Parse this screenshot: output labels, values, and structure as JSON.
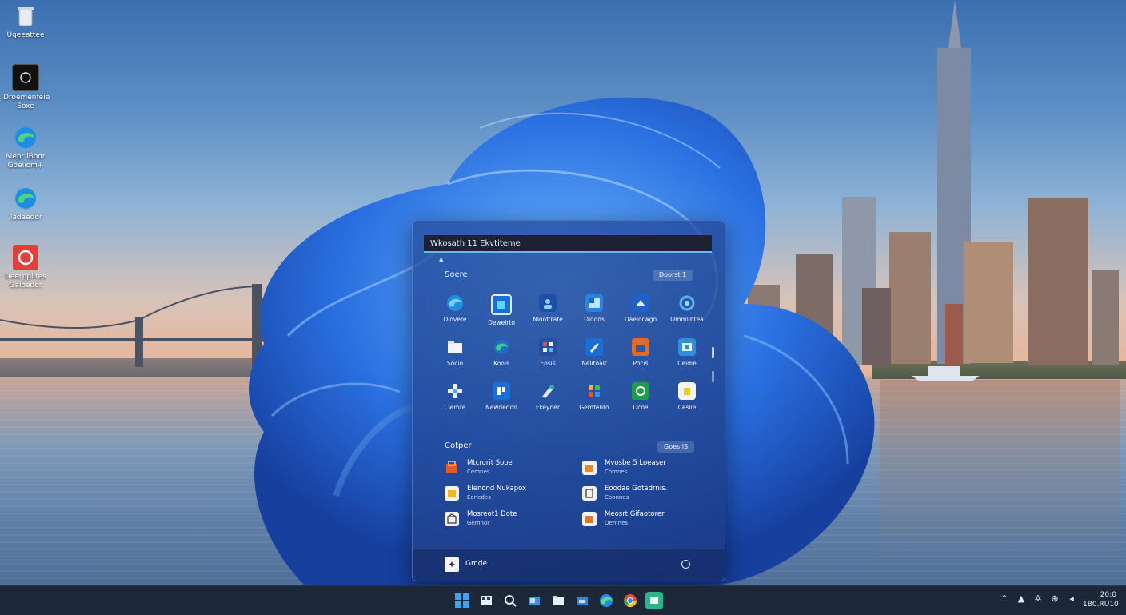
{
  "desktop": {
    "icons": [
      {
        "label": "Uqeeattee",
        "icon": "recycle-bin-icon"
      },
      {
        "label": "Droemenfeie\nSoxe",
        "icon": "store-icon"
      },
      {
        "label": "Mepr lBoor\nGoeliom+",
        "icon": "edge-icon"
      },
      {
        "label": "Tadaedor",
        "icon": "edge-icon"
      },
      {
        "label": "Ueerpplites\nGaloedor",
        "icon": "camera-app-icon"
      }
    ]
  },
  "start_menu": {
    "search_text": "Wkosath 11 Ekvtiteme",
    "search_caret": "▲",
    "pinned_title": "Soere",
    "pinned_button": "Doorst  1",
    "apps": [
      {
        "label": "Dlovere",
        "icon": "edge-icon"
      },
      {
        "label": "Deweirto",
        "icon": "photos-icon"
      },
      {
        "label": "Nlooftrate",
        "icon": "user-app-icon"
      },
      {
        "label": "Dlodos",
        "icon": "mail-icon"
      },
      {
        "label": "Daelorwgo",
        "icon": "store-app-icon"
      },
      {
        "label": "Ommlibtea",
        "icon": "settings-icon"
      },
      {
        "label": "Socio",
        "icon": "folder-icon"
      },
      {
        "label": "Koois",
        "icon": "edge-green-icon"
      },
      {
        "label": "Eosis",
        "icon": "tools-icon"
      },
      {
        "label": "Nelitoalt",
        "icon": "pen-icon"
      },
      {
        "label": "Pocis",
        "icon": "office-icon"
      },
      {
        "label": "Ceidie",
        "icon": "photo-viewer-icon"
      },
      {
        "label": "Clemre",
        "icon": "puzzle-icon"
      },
      {
        "label": "Newdedon",
        "icon": "news-icon"
      },
      {
        "label": "Fkeyner",
        "icon": "paint-icon"
      },
      {
        "label": "Gemfento",
        "icon": "games-icon"
      },
      {
        "label": "Dcoe",
        "icon": "xbox-icon"
      },
      {
        "label": "Ceslie",
        "icon": "notes-icon"
      }
    ],
    "recommended_title": "Cotper",
    "recommended_button": "Goes  iS",
    "recommended": [
      {
        "title": "Mtcrorit Sooe",
        "subtitle": "Cemnes",
        "icon": "store-bag-icon"
      },
      {
        "title": "Mvosbe 5 Loeaser",
        "subtitle": "Comnes",
        "icon": "orange-app-icon"
      },
      {
        "title": "Elenond Nukapox",
        "subtitle": "Eonedes",
        "icon": "yellow-app-icon"
      },
      {
        "title": "Eoodae Gotadrnis.",
        "subtitle": "Coonnes",
        "icon": "doc-icon"
      },
      {
        "title": "Mosreot1 Dote",
        "subtitle": "Gemnor",
        "icon": "box-icon"
      },
      {
        "title": "Meosrt Gifaotorer",
        "subtitle": "Oemnes",
        "icon": "orange-doc-icon"
      }
    ],
    "user_name": "Gmde",
    "user_icon": "user-icon",
    "power_icon": "power-icon"
  },
  "taskbar": {
    "icons": [
      "start-icon",
      "widgets-icon",
      "search-icon",
      "task-view-icon",
      "file-explorer-icon",
      "store-icon",
      "edge-icon",
      "chrome-icon",
      "terminal-icon"
    ],
    "tray_icons": [
      "chevron-up-icon",
      "onedrive-icon",
      "security-icon",
      "network-icon",
      "volume-icon"
    ],
    "time": "20:0",
    "date": "1B0.RU10"
  },
  "colors": {
    "accent": "#3c8cf0",
    "start_bg": "#2a53a6",
    "taskbar_bg": "#1c2838"
  }
}
